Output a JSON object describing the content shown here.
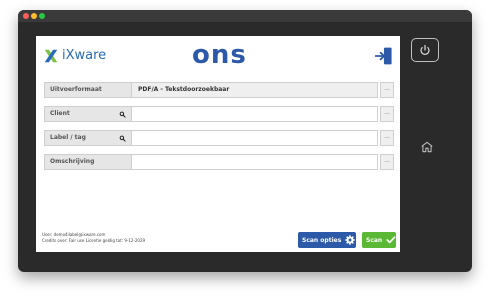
{
  "app": {
    "logo_text": "iXware",
    "center_logo": "ons"
  },
  "form": {
    "fields": [
      {
        "label": "Uitvoerformaat",
        "value": "PDF/A - Tekstdoorzoekbaar",
        "has_search": false
      },
      {
        "label": "Client",
        "value": "",
        "has_search": true
      },
      {
        "label": "Label / tag",
        "value": "",
        "has_search": true
      },
      {
        "label": "Omschrijving",
        "value": "",
        "has_search": false
      }
    ],
    "ellipsis": "..."
  },
  "footer": {
    "user": "User: demo4ilabel@ixware.com",
    "credits": "Credits over: Fair use    Licentie geldig tot: 9-12-2029"
  },
  "buttons": {
    "scan_options": "Scan opties",
    "scan": "Scan"
  },
  "colors": {
    "brand_blue": "#2d5aa8",
    "scan_green": "#5ab834",
    "ix_green": "#7dc243"
  },
  "icons": [
    "power-icon",
    "home-icon",
    "logout-icon",
    "search-icon",
    "gear-icon",
    "check-icon"
  ]
}
